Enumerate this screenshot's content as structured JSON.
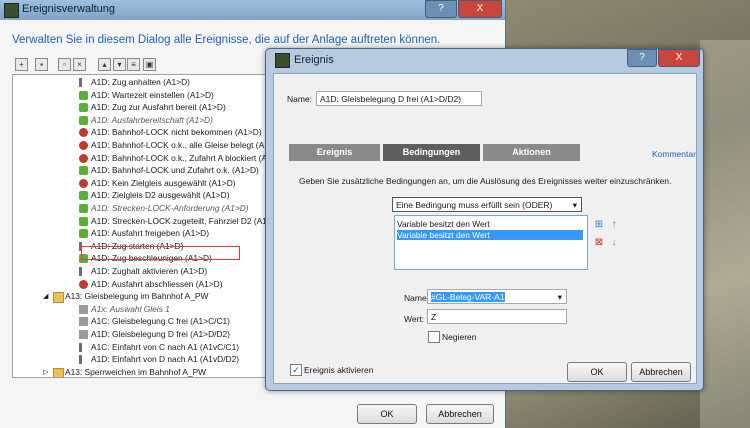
{
  "main_window": {
    "title": "Ereignisverwaltung",
    "close_label": "X",
    "help_label": "?",
    "intro": "Verwalten Sie in diesem Dialog alle Ereignisse, die auf der Anlage auftreten können.",
    "tree": [
      {
        "text": "A1D: Zug anhalten (A1>D)",
        "icon": "signal-icon",
        "italic": false
      },
      {
        "text": "A1D: Wartezeit einstellen (A1>D)",
        "icon": "green-arrow-icon",
        "italic": false
      },
      {
        "text": "A1D: Zug zur Ausfahrt bereit (A1>D)",
        "icon": "green-arrow-icon",
        "italic": false
      },
      {
        "text": "A1D: Ausfahrbereitschaft (A1>D)",
        "icon": "green-arrow-icon",
        "italic": true
      },
      {
        "text": "A1D: Bahnhof-LOCK nicht bekommen (A1>D)",
        "icon": "red-stop-icon",
        "italic": false
      },
      {
        "text": "A1D: Bahnhof-LOCK o.k., alle Gleise belegt (A1>D)",
        "icon": "red-stop-icon",
        "italic": false
      },
      {
        "text": "A1D: Bahnhof-LOCK o.k., Zufahrt A blockiert (A1>D)",
        "icon": "red-stop-icon",
        "italic": false
      },
      {
        "text": "A1D: Bahnhof-LOCK und Zufahrt o.k. (A1>D)",
        "icon": "green-arrow-icon",
        "italic": false
      },
      {
        "text": "A1D: Kein Zielgleis ausgewählt (A1>D)",
        "icon": "red-stop-icon",
        "italic": false
      },
      {
        "text": "A1D: Zielgleis D2 ausgewählt (A1>D)",
        "icon": "green-arrow-icon",
        "italic": false
      },
      {
        "text": "A1D: Strecken-LOCK-Anforderung (A1>D)",
        "icon": "green-arrow-icon",
        "italic": true
      },
      {
        "text": "A1D: Strecken-LOCK zugeteilt, Fahrziel D2 (A1>D)",
        "icon": "green-arrow-icon",
        "italic": false
      },
      {
        "text": "A1D: Ausfahrt freigeben (A1>D)",
        "icon": "green-arrow-icon",
        "italic": false
      },
      {
        "text": "A1D: Zug starten (A1>D)",
        "icon": "signal-icon",
        "italic": false
      },
      {
        "text": "A1D: Zug beschleunigen (A1>D)",
        "icon": "green-arrow-icon",
        "italic": false
      },
      {
        "text": "A1D: Zughalt aktivieren (A1>D)",
        "icon": "signal-icon",
        "italic": false
      },
      {
        "text": "A1D: Ausfahrt abschliessen (A1>D)",
        "icon": "red-stop-icon",
        "italic": false
      },
      {
        "text": "A13: Gleisbelegung im Bahnhof A_PW",
        "icon": "folder-icon",
        "italic": false
      },
      {
        "text": "A1x: Auswahl Gleis 1",
        "icon": "grey-item-icon",
        "italic": true
      },
      {
        "text": "A1C: Gleisbelegung C frei (A1>C/C1)",
        "icon": "grey-item-icon",
        "italic": false
      },
      {
        "text": "A1D: Gleisbelegung D frei (A1>D/D2)",
        "icon": "grey-item-icon",
        "italic": false
      },
      {
        "text": "A1C: Einfahrt von C nach A1 (A1vC/C1)",
        "icon": "signal-icon",
        "italic": false
      },
      {
        "text": "A1D: Einfahrt von D nach A1 (A1vD/D2)",
        "icon": "signal-icon",
        "italic": false
      },
      {
        "text": "A13: Sperrweichen im Bahnhof A_PW",
        "icon": "folder-icon",
        "italic": false
      }
    ],
    "ok_label": "OK",
    "cancel_label": "Abbrechen"
  },
  "dialog": {
    "title": "Ereignis",
    "close_label": "X",
    "help_label": "?",
    "name_label": "Name:",
    "name_value": "A1D: Gleisbelegung D frei (A1>D/D2)",
    "tabs": [
      "Ereignis",
      "Bedingungen",
      "Aktionen"
    ],
    "comment_link": "Kommentar",
    "description": "Geben Sie zusätzliche Bedingungen an, um die Auslösung des Ereignisses weiter einzuschränken.",
    "condition_mode": "Eine Bedingung muss erfüllt sein (ODER)",
    "conditions": [
      "Variable besitzt den Wert",
      "Variable besitzt den Wert"
    ],
    "var_name_label": "Name:",
    "var_name_value": "#GL-Beleg-VAR-A1",
    "value_label": "Wert:",
    "value_value": "Z",
    "negate_label": "Negieren",
    "active_label": "Ereignis aktivieren",
    "ok_label": "OK",
    "cancel_label": "Abbrechen"
  }
}
